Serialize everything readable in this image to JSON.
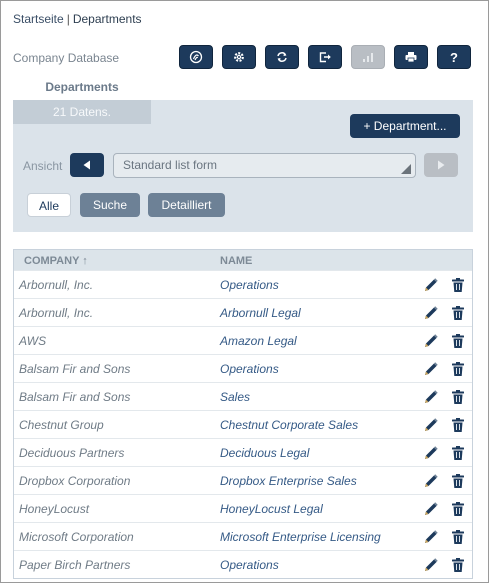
{
  "breadcrumb": {
    "home": "Startseite",
    "separator": "|",
    "current": "Departments"
  },
  "database_name": "Company Database",
  "toolbar": {
    "buttons": [
      {
        "icon": "fingerprint-icon",
        "enabled": true
      },
      {
        "icon": "gear-icon",
        "enabled": true
      },
      {
        "icon": "refresh-icon",
        "enabled": true
      },
      {
        "icon": "export-icon",
        "enabled": true
      },
      {
        "icon": "chart-icon",
        "enabled": false
      },
      {
        "icon": "print-icon",
        "enabled": true
      },
      {
        "icon": "help-icon",
        "label": "?",
        "enabled": true
      }
    ]
  },
  "tab": {
    "label": "Departments",
    "count": "21 Datens."
  },
  "add_button": "+ Department...",
  "view": {
    "label": "Ansicht",
    "selected": "Standard list form"
  },
  "filters": {
    "all": "Alle",
    "search": "Suche",
    "detailed": "Detailliert",
    "active": "all"
  },
  "table": {
    "columns": [
      "COMPANY ↑",
      "NAME"
    ],
    "rows": [
      {
        "company": "Arbornull, Inc.",
        "name": "Operations"
      },
      {
        "company": "Arbornull, Inc.",
        "name": "Arbornull Legal"
      },
      {
        "company": "AWS",
        "name": "Amazon Legal"
      },
      {
        "company": "Balsam Fir and Sons",
        "name": "Operations"
      },
      {
        "company": "Balsam Fir and Sons",
        "name": "Sales"
      },
      {
        "company": "Chestnut Group",
        "name": "Chestnut Corporate Sales"
      },
      {
        "company": "Deciduous Partners",
        "name": "Deciduous Legal"
      },
      {
        "company": "Dropbox Corporation",
        "name": "Dropbox Enterprise Sales"
      },
      {
        "company": "HoneyLocust",
        "name": "HoneyLocust Legal"
      },
      {
        "company": "Microsoft Corporation",
        "name": "Microsoft Enterprise Licensing"
      },
      {
        "company": "Paper Birch Partners",
        "name": "Operations"
      }
    ]
  },
  "colors": {
    "primary": "#1d3a5c",
    "panel": "#dbe3ea",
    "disabled": "#b9bec4",
    "link": "#355a86"
  }
}
